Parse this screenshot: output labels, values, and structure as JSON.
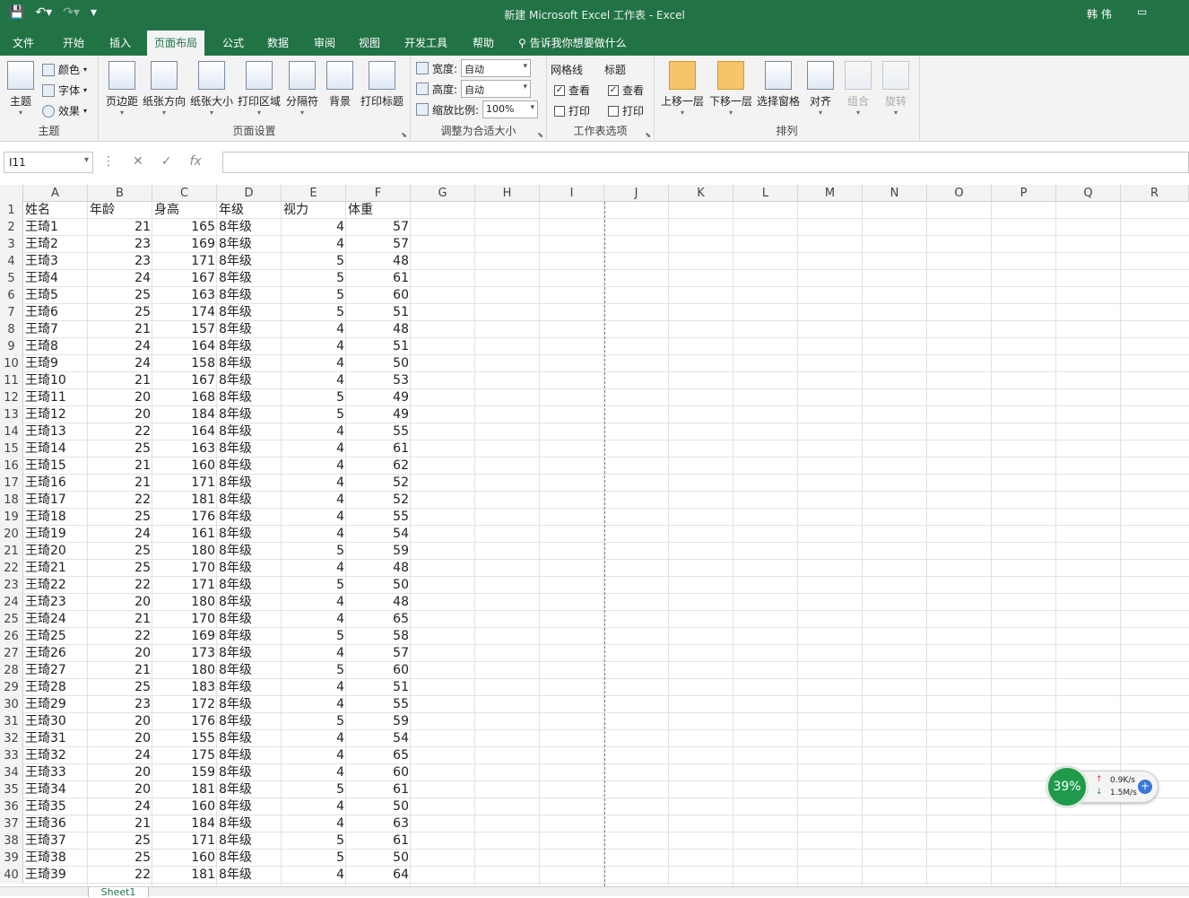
{
  "title": "新建 Microsoft Excel 工作表 - Excel",
  "user": "韩 伟",
  "tabs": [
    "文件",
    "开始",
    "插入",
    "页面布局",
    "公式",
    "数据",
    "审阅",
    "视图",
    "开发工具",
    "帮助"
  ],
  "active_tab": "页面布局",
  "tell_me": "告诉我你想要做什么",
  "ribbon": {
    "theme_group": {
      "label": "主题",
      "theme": "主题",
      "colors": "颜色",
      "fonts": "字体",
      "effects": "效果"
    },
    "page_setup": {
      "label": "页面设置",
      "buttons": [
        "页边距",
        "纸张方向",
        "纸张大小",
        "打印区域",
        "分隔符",
        "背景",
        "打印标题"
      ]
    },
    "scale": {
      "label": "调整为合适大小",
      "width_label": "宽度:",
      "width_value": "自动",
      "height_label": "高度:",
      "height_value": "自动",
      "scale_label": "缩放比例:",
      "scale_value": "100%"
    },
    "sheet_options": {
      "label": "工作表选项",
      "gridlines": "网格线",
      "headings": "标题",
      "view": "查看",
      "print": "打印"
    },
    "arrange": {
      "label": "排列",
      "buttons": [
        "上移一层",
        "下移一层",
        "选择窗格",
        "对齐",
        "组合",
        "旋转"
      ]
    }
  },
  "name_box": "I11",
  "fx": "fx",
  "columns": [
    "A",
    "B",
    "C",
    "D",
    "E",
    "F",
    "G",
    "H",
    "I",
    "J",
    "K",
    "L",
    "M",
    "N",
    "O",
    "P",
    "Q",
    "R"
  ],
  "header_row": [
    "姓名",
    "年龄",
    "身高",
    "年级",
    "视力",
    "体重"
  ],
  "data_rows": [
    [
      "王琦1",
      "21",
      "165",
      "8年级",
      "4",
      "57"
    ],
    [
      "王琦2",
      "23",
      "169",
      "8年级",
      "4",
      "57"
    ],
    [
      "王琦3",
      "23",
      "171",
      "8年级",
      "5",
      "48"
    ],
    [
      "王琦4",
      "24",
      "167",
      "8年级",
      "5",
      "61"
    ],
    [
      "王琦5",
      "25",
      "163",
      "8年级",
      "5",
      "60"
    ],
    [
      "王琦6",
      "25",
      "174",
      "8年级",
      "5",
      "51"
    ],
    [
      "王琦7",
      "21",
      "157",
      "8年级",
      "4",
      "48"
    ],
    [
      "王琦8",
      "24",
      "164",
      "8年级",
      "4",
      "51"
    ],
    [
      "王琦9",
      "24",
      "158",
      "8年级",
      "4",
      "50"
    ],
    [
      "王琦10",
      "21",
      "167",
      "8年级",
      "4",
      "53"
    ],
    [
      "王琦11",
      "20",
      "168",
      "8年级",
      "5",
      "49"
    ],
    [
      "王琦12",
      "20",
      "184",
      "8年级",
      "5",
      "49"
    ],
    [
      "王琦13",
      "22",
      "164",
      "8年级",
      "4",
      "55"
    ],
    [
      "王琦14",
      "25",
      "163",
      "8年级",
      "4",
      "61"
    ],
    [
      "王琦15",
      "21",
      "160",
      "8年级",
      "4",
      "62"
    ],
    [
      "王琦16",
      "21",
      "171",
      "8年级",
      "4",
      "52"
    ],
    [
      "王琦17",
      "22",
      "181",
      "8年级",
      "4",
      "52"
    ],
    [
      "王琦18",
      "25",
      "176",
      "8年级",
      "4",
      "55"
    ],
    [
      "王琦19",
      "24",
      "161",
      "8年级",
      "4",
      "54"
    ],
    [
      "王琦20",
      "25",
      "180",
      "8年级",
      "5",
      "59"
    ],
    [
      "王琦21",
      "25",
      "170",
      "8年级",
      "4",
      "48"
    ],
    [
      "王琦22",
      "22",
      "171",
      "8年级",
      "5",
      "50"
    ],
    [
      "王琦23",
      "20",
      "180",
      "8年级",
      "4",
      "48"
    ],
    [
      "王琦24",
      "21",
      "170",
      "8年级",
      "4",
      "65"
    ],
    [
      "王琦25",
      "22",
      "169",
      "8年级",
      "5",
      "58"
    ],
    [
      "王琦26",
      "20",
      "173",
      "8年级",
      "4",
      "57"
    ],
    [
      "王琦27",
      "21",
      "180",
      "8年级",
      "5",
      "60"
    ],
    [
      "王琦28",
      "25",
      "183",
      "8年级",
      "4",
      "51"
    ],
    [
      "王琦29",
      "23",
      "172",
      "8年级",
      "4",
      "55"
    ],
    [
      "王琦30",
      "20",
      "176",
      "8年级",
      "5",
      "59"
    ],
    [
      "王琦31",
      "20",
      "155",
      "8年级",
      "4",
      "54"
    ],
    [
      "王琦32",
      "24",
      "175",
      "8年级",
      "4",
      "65"
    ],
    [
      "王琦33",
      "20",
      "159",
      "8年级",
      "4",
      "60"
    ],
    [
      "王琦34",
      "20",
      "181",
      "8年级",
      "5",
      "61"
    ],
    [
      "王琦35",
      "24",
      "160",
      "8年级",
      "4",
      "50"
    ],
    [
      "王琦36",
      "21",
      "184",
      "8年级",
      "4",
      "63"
    ],
    [
      "王琦37",
      "25",
      "171",
      "8年级",
      "5",
      "61"
    ],
    [
      "王琦38",
      "25",
      "160",
      "8年级",
      "5",
      "50"
    ],
    [
      "王琦39",
      "22",
      "181",
      "8年级",
      "4",
      "64"
    ]
  ],
  "sheet_tab": "Sheet1",
  "net_widget": {
    "percent": "39%",
    "up": "0.9K/s",
    "down": "1.5M/s"
  }
}
